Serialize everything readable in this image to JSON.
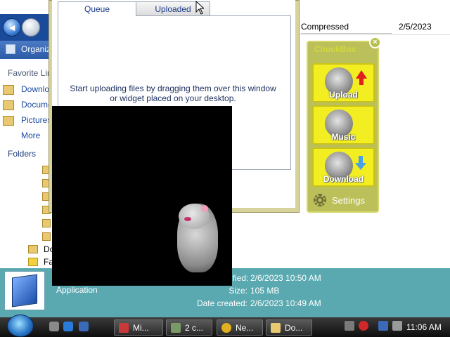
{
  "explorer": {
    "organize_label": "Organize",
    "favorite_links_title": "Favorite Links",
    "side_items": [
      "Downloads",
      "Documents",
      "Pictures"
    ],
    "more_label": "More",
    "folders_label": "Folders",
    "tree_items": [
      "Downloads",
      "Favorites"
    ],
    "columns": {
      "type": "Compressed",
      "date": "2/5/2023"
    }
  },
  "details": {
    "type": "Application",
    "modified_key": "Date modified:",
    "modified_val": "2/6/2023 10:50 AM",
    "size_key": "Size:",
    "size_val": "105 MB",
    "created_key": "Date created:",
    "created_val": "2/6/2023 10:49 AM"
  },
  "uploader": {
    "tabs": [
      "Queue",
      "Uploaded"
    ],
    "drop_hint": "Start uploading files by dragging them over this window or widget placed on your desktop."
  },
  "widget": {
    "title": "ChuckBox",
    "buttons": [
      "Upload",
      "Music",
      "Download"
    ],
    "settings_label": "Settings",
    "close_label": "×"
  },
  "taskbar": {
    "tasks": [
      "Mi...",
      "2 c...",
      "Ne...",
      "Do..."
    ],
    "clock": "11:06 AM"
  }
}
